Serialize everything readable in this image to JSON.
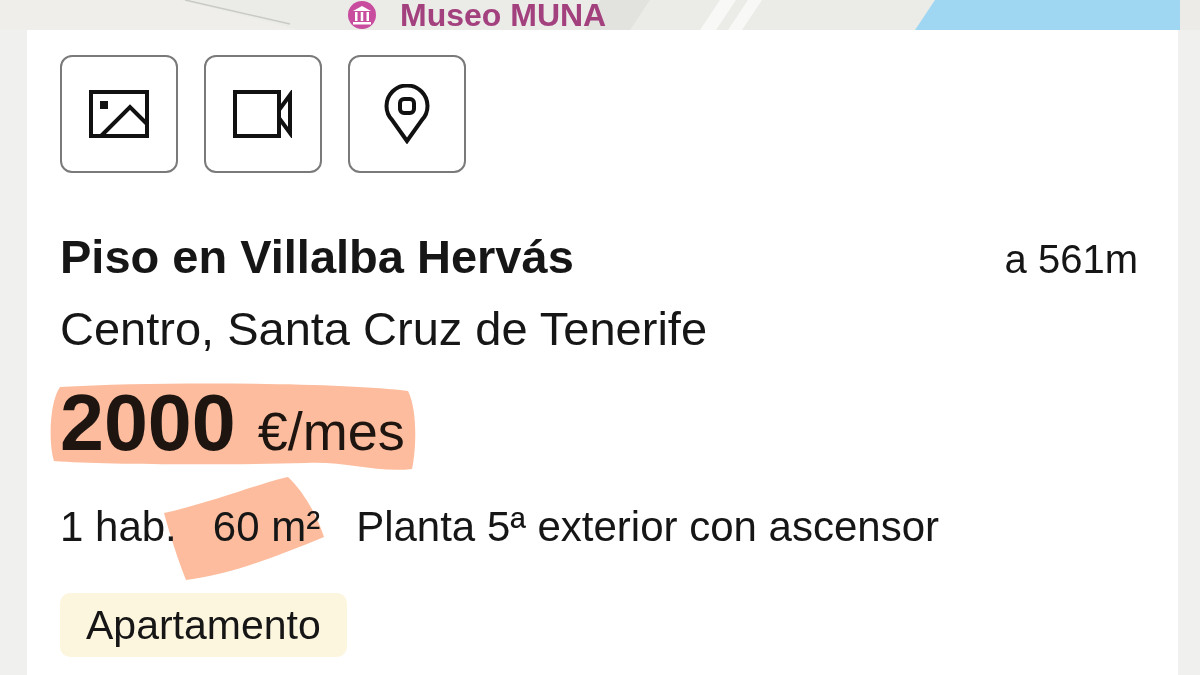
{
  "map": {
    "place_label": "Museo MUNA"
  },
  "media_buttons": [
    {
      "kind": "photos"
    },
    {
      "kind": "video"
    },
    {
      "kind": "map"
    }
  ],
  "listing": {
    "title": "Piso en Villalba Hervás",
    "distance": "a 561m",
    "location": "Centro, Santa Cruz de Tenerife",
    "price": {
      "amount": "2000",
      "unit": "€/mes",
      "highlighted": true
    },
    "details": [
      {
        "text": "1 hab.",
        "highlighted": false
      },
      {
        "text": "60 m²",
        "highlighted": true
      },
      {
        "text": "Planta 5ª exterior con ascensor",
        "highlighted": false
      }
    ],
    "tag": "Apartamento"
  }
}
